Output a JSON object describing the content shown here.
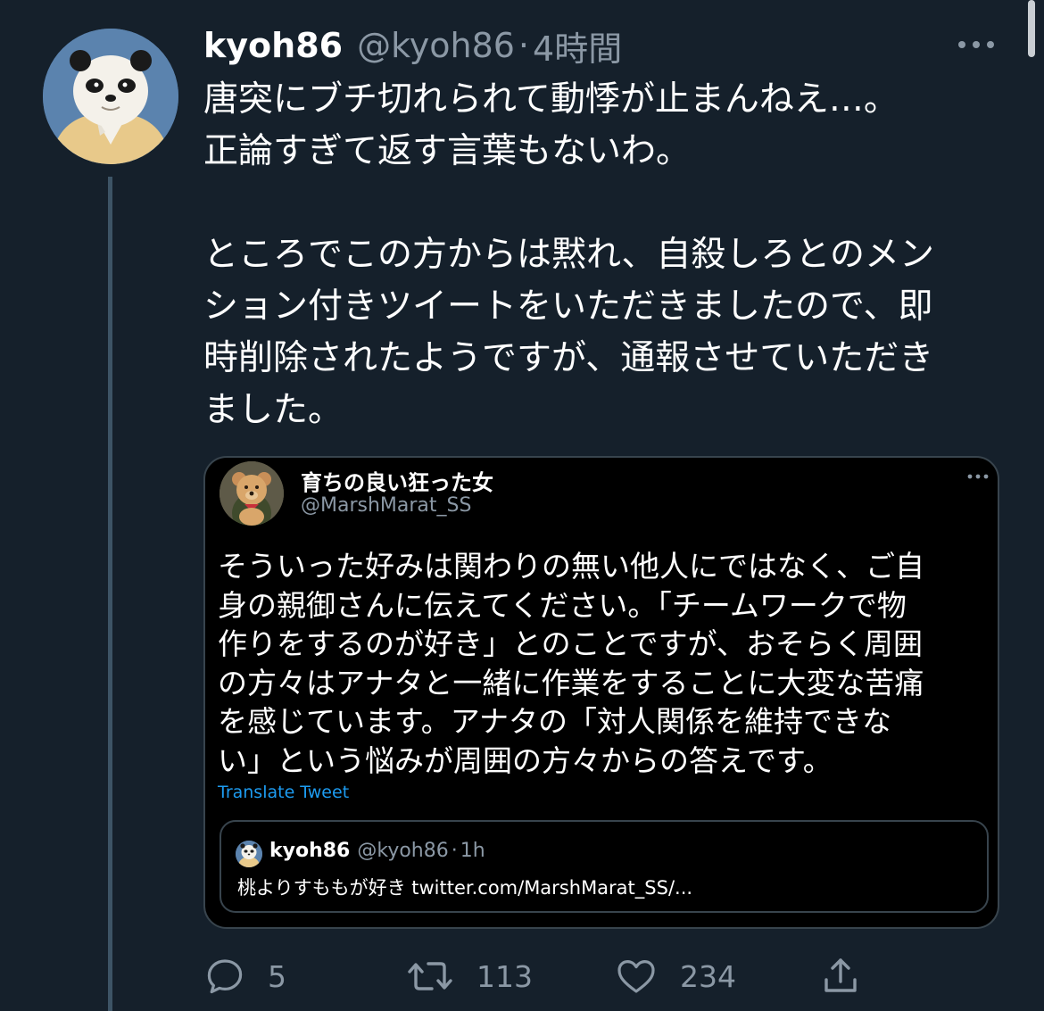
{
  "tweet": {
    "display_name": "kyoh86",
    "handle": "@kyoh86",
    "separator": "·",
    "time": "4時間",
    "text_lines": [
      "唐突にブチ切れられて動悸が止まんねえ…。",
      "正論すぎて返す言葉もないわ。",
      "",
      "ところでこの方からは黙れ、自殺しろとのメン",
      "ション付きツイートをいただきましたので、即",
      "時削除されたようですが、通報させていただき",
      "ました。"
    ]
  },
  "quoted_tweet": {
    "display_name": "育ちの良い狂った女",
    "handle": "@MarshMarat_SS",
    "text_lines": [
      "そういった好みは関わりの無い他人にではなく、ご自",
      "身の親御さんに伝えてください。「チームワークで物",
      "作りをするのが好き」とのことですが、おそらく周囲",
      "の方々はアナタと一緒に作業をすることに大変な苦痛",
      "を感じています。アナタの「対人関係を維持できな",
      "い」という悩みが周囲の方々からの答えです。"
    ],
    "translate_label": "Translate Tweet",
    "nested_quote": {
      "display_name": "kyoh86",
      "handle": "@kyoh86",
      "separator": "·",
      "time": "1h",
      "text": "桃よりすももが好き twitter.com/MarshMarat_SS/..."
    }
  },
  "actions": {
    "reply_count": "5",
    "retweet_count": "113",
    "like_count": "234"
  },
  "icons": {
    "more": "more-horizontal-icon",
    "reply": "reply-icon",
    "retweet": "retweet-icon",
    "like": "heart-icon",
    "share": "share-icon"
  },
  "colors": {
    "background": "#15202b",
    "secondary_text": "#8b98a5",
    "link": "#1d9bf0",
    "border": "#38444d"
  }
}
